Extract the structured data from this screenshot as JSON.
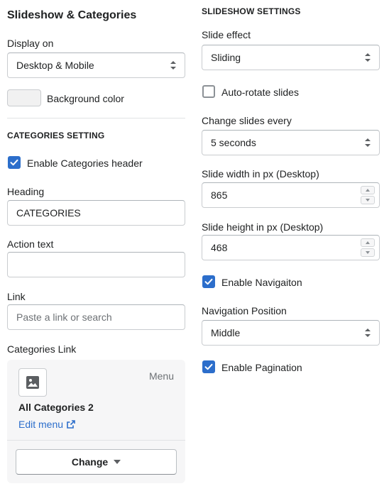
{
  "left": {
    "title": "Slideshow & Categories",
    "display_on": {
      "label": "Display on",
      "value": "Desktop & Mobile"
    },
    "background_color": {
      "label": "Background color",
      "swatch": "#f1f1f1"
    },
    "categories_section": {
      "heading": "CATEGORIES SETTING",
      "enable_header": {
        "label": "Enable Categories header",
        "checked": true
      },
      "heading_field": {
        "label": "Heading",
        "value": "CATEGORIES"
      },
      "action_text": {
        "label": "Action text",
        "value": ""
      },
      "link": {
        "label": "Link",
        "placeholder": "Paste a link or search"
      },
      "categories_link": {
        "label": "Categories Link",
        "badge": "Menu",
        "menu_name": "All Categories 2",
        "edit_label": "Edit menu",
        "change_label": "Change"
      }
    }
  },
  "right": {
    "heading": "SLIDESHOW SETTINGS",
    "slide_effect": {
      "label": "Slide effect",
      "value": "Sliding"
    },
    "auto_rotate": {
      "label": "Auto-rotate slides",
      "checked": false
    },
    "change_every": {
      "label": "Change slides every",
      "value": "5 seconds"
    },
    "slide_width": {
      "label": "Slide width in px (Desktop)",
      "value": "865"
    },
    "slide_height": {
      "label": "Slide height in px (Desktop)",
      "value": "468"
    },
    "enable_navigation": {
      "label": "Enable Navigaiton",
      "checked": true
    },
    "navigation_position": {
      "label": "Navigation Position",
      "value": "Middle"
    },
    "enable_pagination": {
      "label": "Enable Pagination",
      "checked": true
    }
  },
  "colors": {
    "accent": "#2c6ecb",
    "border": "#c9cccf",
    "card_bg": "#f6f6f7"
  },
  "icons": [
    "select-arrows-icon",
    "checkmark-icon",
    "image-icon",
    "external-link-icon",
    "caret-down-icon",
    "stepper-up-icon",
    "stepper-down-icon"
  ]
}
